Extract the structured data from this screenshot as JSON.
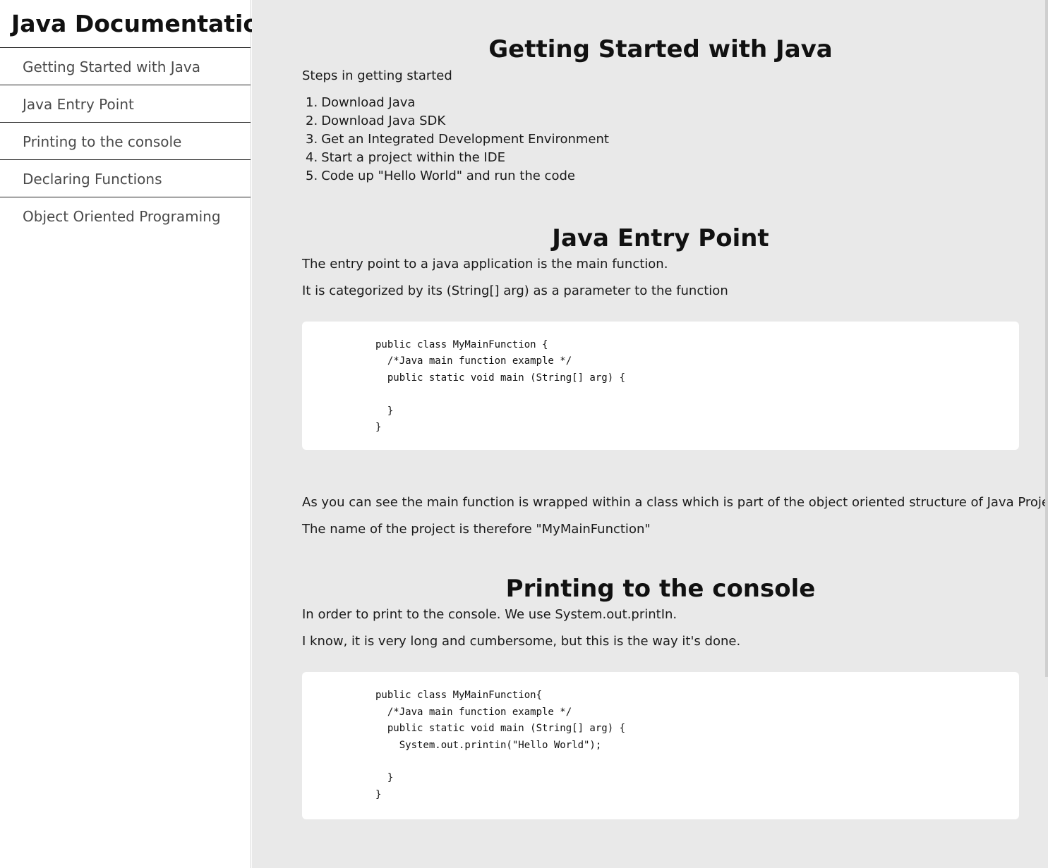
{
  "navbar": {
    "title": "Java Documentation",
    "items": [
      {
        "label": "Getting Started with Java"
      },
      {
        "label": "Java Entry Point"
      },
      {
        "label": "Printing to the console"
      },
      {
        "label": "Declaring Functions"
      },
      {
        "label": "Object Oriented Programing"
      }
    ]
  },
  "sections": {
    "getting_started": {
      "title": "Getting Started with Java",
      "intro": "Steps in getting started",
      "steps": [
        {
          "num": "1.",
          "text": "Download Java"
        },
        {
          "num": "2.",
          "text": "Download Java SDK"
        },
        {
          "num": "3.",
          "text": "Get an Integrated Development Environment"
        },
        {
          "num": "4.",
          "text": "Start a project within the IDE"
        },
        {
          "num": "5.",
          "text": "Code up \"Hello World\" and run the code"
        }
      ]
    },
    "entry_point": {
      "title": "Java Entry Point",
      "p1": "The entry point to a java application is the main function.",
      "p2": "It is categorized by its (String[] arg) as a parameter to the function",
      "code": [
        "public class MyMainFunction {",
        "  /*Java main function example */",
        "  public static void main (String[] arg) {",
        "",
        "  }",
        "}"
      ],
      "p3": "As you can see the main function is wrapped within a class which is part of the object oriented structure of Java Projects.",
      "p4": "The name of the project is therefore \"MyMainFunction\""
    },
    "printing": {
      "title": "Printing to the console",
      "p1": "In order to print to the console. We use System.out.printIn.",
      "p2": "I know, it is very long and cumbersome, but this is the way it's done.",
      "code": [
        "public class MyMainFunction{",
        "  /*Java main function example */",
        "  public static void main (String[] arg) {",
        "    System.out.printin(\"Hello World\");",
        "",
        "  }",
        "}"
      ]
    }
  }
}
